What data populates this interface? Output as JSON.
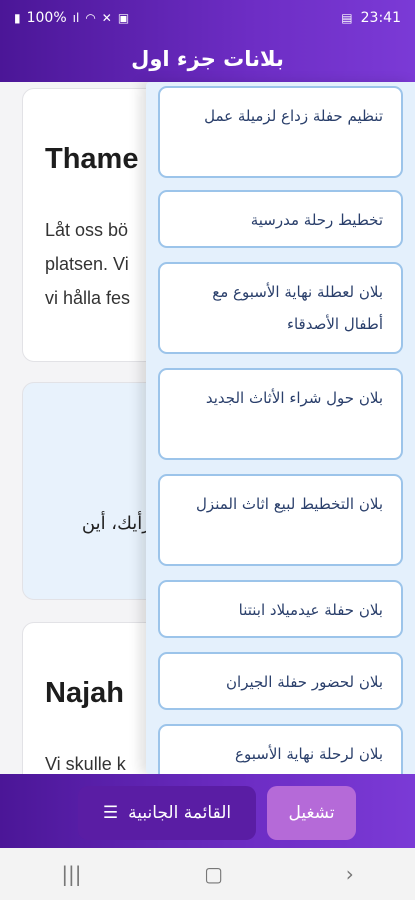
{
  "status": {
    "battery_pct": "100%",
    "time": "23:41",
    "icons": [
      "battery-icon",
      "signal-icon",
      "wifi-icon",
      "mute-icon",
      "lock-icon",
      "screenshot-icon"
    ]
  },
  "app_bar": {
    "title": "بلانات جزء اول"
  },
  "cards": [
    {
      "title": "Thame",
      "body": "Låt oss bö\nplatsen. Vi\nvi hålla fes"
    },
    {
      "body_ar": "رأيك، أين"
    },
    {
      "title": "Najah",
      "body": "Vi skulle k"
    }
  ],
  "plans": [
    "تنظيم حفلة زداع لزميلة عمل",
    "تخطيط رحلة مدرسية",
    "بلان لعطلة نهاية الأسبوع مع أطفال الأصدقاء",
    "بلان حول شراء الأثاث الجديد",
    "بلان التخطيط لبيع اثاث المنزل",
    "بلان حفلة عيدميلاد ابنتنا",
    "بلان لحضور حفلة الجيران",
    "بلان لرحلة نهاية الأسبوع"
  ],
  "bottom_bar": {
    "sidebar_label": "القائمة الجانبية",
    "sidebar_icon": "menu-icon",
    "run_label": "تشغيل"
  },
  "nav": {
    "icons": [
      "recents-icon",
      "home-icon",
      "back-icon"
    ]
  }
}
